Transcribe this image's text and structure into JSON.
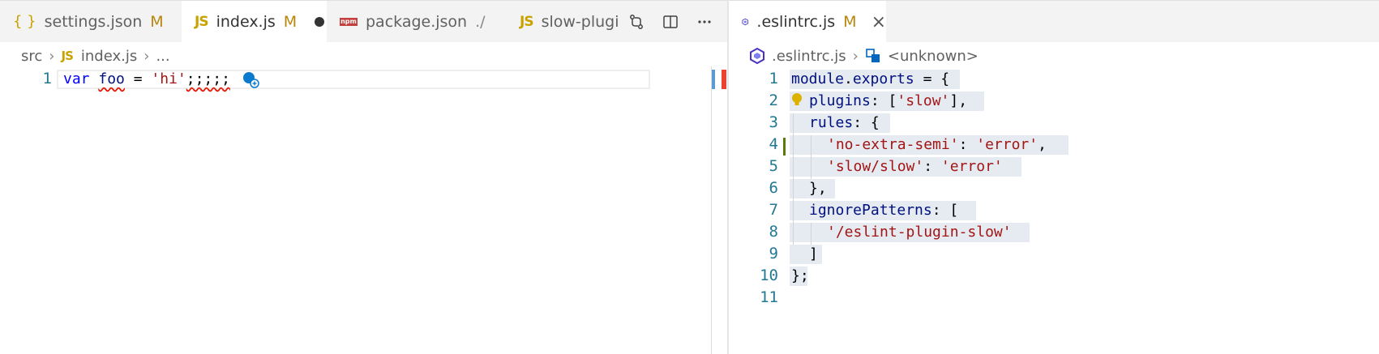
{
  "left_editor": {
    "tabs": [
      {
        "icon": "{ }",
        "label": "settings.json",
        "status": "M"
      },
      {
        "icon": "JS",
        "label": "index.js",
        "status": "M",
        "active": true
      },
      {
        "icon": "npm",
        "label": "package.json",
        "status": "./"
      },
      {
        "icon": "JS",
        "label": "slow-plugi"
      }
    ],
    "breadcrumb": {
      "folder": "src",
      "file_icon": "JS",
      "file": "index.js",
      "more": "..."
    },
    "lines": [
      {
        "num": "1",
        "kw": "var",
        "name": "foo",
        "eq": " = ",
        "str": "'hi'",
        "tail": ";;;;;"
      }
    ]
  },
  "right_editor": {
    "tab": {
      "label": ".eslintrc.js",
      "status": "M"
    },
    "breadcrumb": {
      "file": ".eslintrc.js",
      "symbol": "<unknown>"
    },
    "line_numbers": [
      "1",
      "2",
      "3",
      "4",
      "5",
      "6",
      "7",
      "8",
      "9",
      "10",
      "11"
    ],
    "code": {
      "l1_a": "module",
      "l1_b": ".",
      "l1_c": "exports",
      "l1_d": " = {",
      "l2_a": "plugins",
      "l2_b": ": [",
      "l2_c": "'slow'",
      "l2_d": "],",
      "l3_a": "rules",
      "l3_b": ": {",
      "l4_a": "'no-extra-semi'",
      "l4_b": ": ",
      "l4_c": "'error'",
      "l4_d": ",",
      "l5_a": "'slow/slow'",
      "l5_b": ": ",
      "l5_c": "'error'",
      "l6": "},",
      "l7_a": "ignorePatterns",
      "l7_b": ": [",
      "l8": "'/eslint-plugin-slow'",
      "l9": "]",
      "l10": "};"
    }
  },
  "colors": {
    "keyword": "#0000ff",
    "variable": "#001080",
    "string": "#a31515",
    "line_number": "#237893",
    "modified": "#b8860b"
  }
}
